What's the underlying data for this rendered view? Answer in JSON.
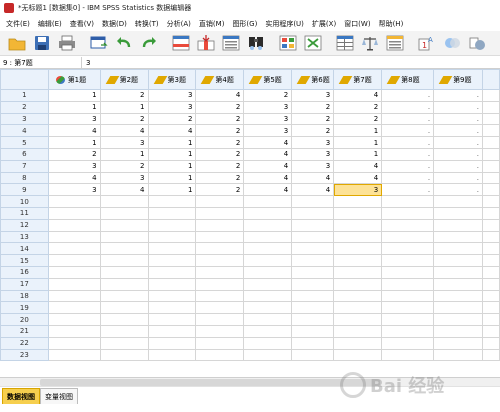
{
  "window": {
    "title": "*无标题1 [数据集0] - IBM SPSS Statistics 数据编辑器"
  },
  "menu": [
    "文件(E)",
    "编辑(E)",
    "查看(V)",
    "数据(D)",
    "转换(T)",
    "分析(A)",
    "直销(M)",
    "图形(G)",
    "实用程序(U)",
    "扩展(X)",
    "窗口(W)",
    "帮助(H)"
  ],
  "toolbar": {
    "icons": [
      "open-folder-icon",
      "save-icon",
      "print-icon",
      "dialog-recall-icon",
      "undo-icon",
      "redo-icon",
      "goto-case-icon",
      "goto-variable-icon",
      "variables-icon",
      "find-icon",
      "insert-cases-icon",
      "insert-variable-icon",
      "split-file-icon",
      "weight-cases-icon",
      "select-cases-icon",
      "value-labels-icon",
      "use-sets-icon",
      "show-all-icon"
    ]
  },
  "cell_ref": {
    "ref": "9 : 第7题",
    "value": "3"
  },
  "table": {
    "columns": [
      "第1题",
      "第2题",
      "第3题",
      "第4题",
      "第5题",
      "第6题",
      "第7题",
      "第8题",
      "第9题"
    ],
    "rows": [
      [
        "1",
        "1",
        "2",
        "3",
        "4",
        "2",
        "3",
        "4",
        ".",
        "."
      ],
      [
        "2",
        "1",
        "1",
        "3",
        "2",
        "3",
        "2",
        "2",
        ".",
        "."
      ],
      [
        "3",
        "3",
        "2",
        "2",
        "2",
        "3",
        "2",
        "2",
        ".",
        "."
      ],
      [
        "4",
        "4",
        "4",
        "4",
        "2",
        "3",
        "2",
        "1",
        ".",
        "."
      ],
      [
        "5",
        "1",
        "3",
        "1",
        "2",
        "4",
        "3",
        "1",
        ".",
        "."
      ],
      [
        "6",
        "2",
        "1",
        "1",
        "2",
        "4",
        "3",
        "1",
        ".",
        "."
      ],
      [
        "7",
        "3",
        "2",
        "1",
        "2",
        "4",
        "3",
        "4",
        ".",
        "."
      ],
      [
        "8",
        "4",
        "3",
        "1",
        "2",
        "4",
        "4",
        "4",
        ".",
        "."
      ],
      [
        "9",
        "3",
        "4",
        "1",
        "2",
        "4",
        "4",
        "3",
        ".",
        "."
      ]
    ],
    "empty_rows": [
      "10",
      "11",
      "12",
      "13",
      "14",
      "15",
      "16",
      "17",
      "18",
      "19",
      "20",
      "21",
      "22",
      "23"
    ],
    "selected_cell": {
      "row": "9",
      "column": "第7题"
    }
  },
  "tabs": {
    "data_view": "数据视图",
    "variable_view": "变量视图"
  },
  "watermark": "Bai 经验"
}
